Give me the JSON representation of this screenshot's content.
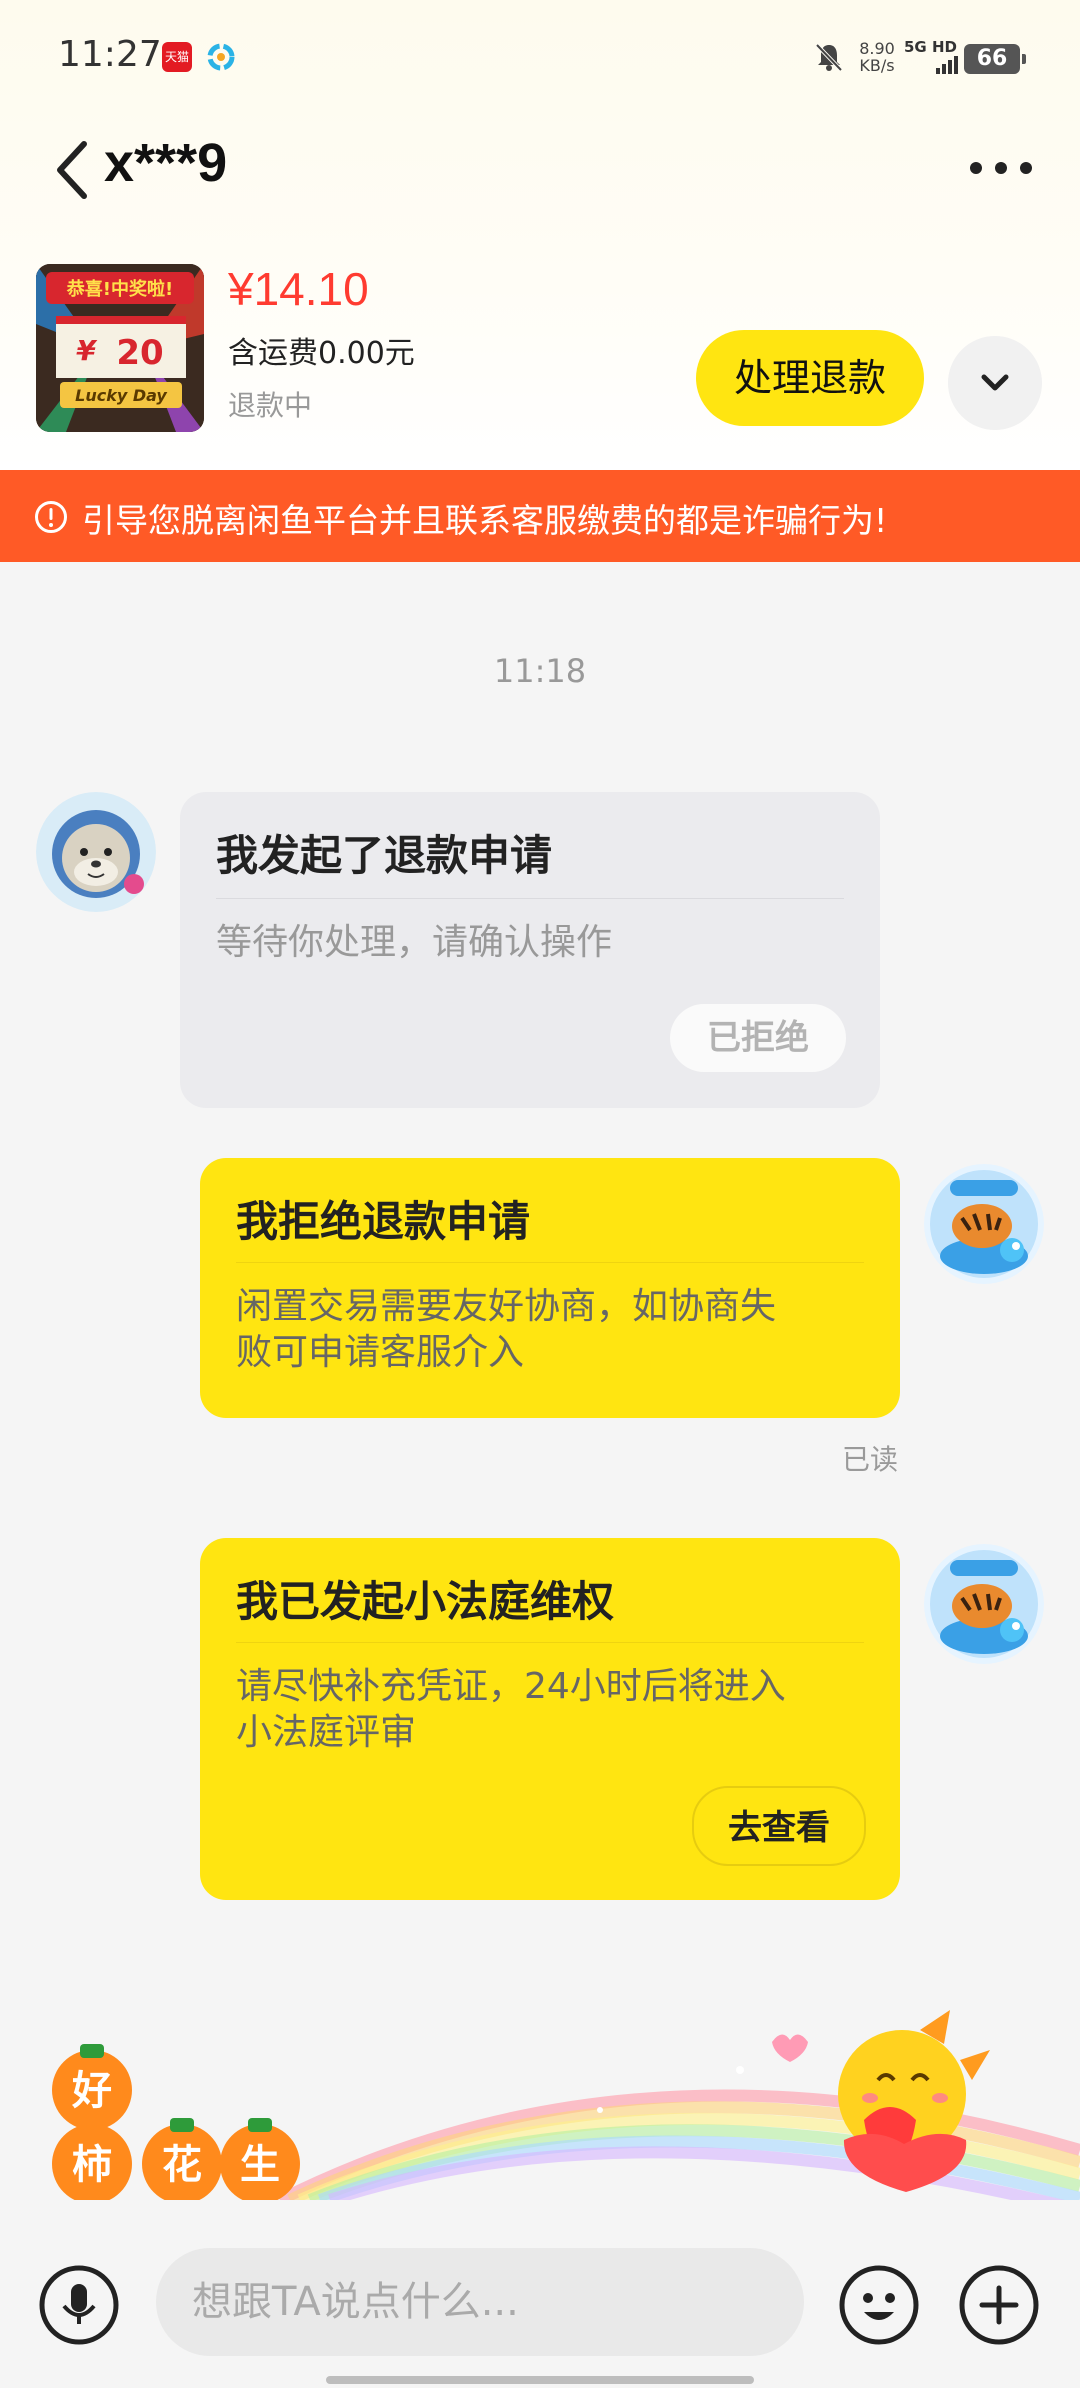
{
  "status_bar": {
    "time": "11:27",
    "app_badge_1": "天猫",
    "net_speed_value": "8.90",
    "net_speed_unit": "KB/s",
    "network": "5G HD",
    "battery": "66"
  },
  "header": {
    "contact_name": "x***9"
  },
  "product": {
    "price": "¥14.10",
    "shipping": "含运费0.00元",
    "status": "退款中",
    "thumb_banner": "恭喜!中奖啦!",
    "thumb_number": "20",
    "thumb_tag": "Lucky Day",
    "action_label": "处理退款"
  },
  "warning": {
    "text": "引导您脱离闲鱼平台并且联系客服缴费的都是诈骗行为!"
  },
  "chat": {
    "timestamp": "11:18",
    "messages": [
      {
        "title": "我发起了退款申请",
        "body": "等待你处理，请确认操作",
        "button": "已拒绝"
      },
      {
        "title": "我拒绝退款申请",
        "body_line1": "闲置交易需要友好协商，如协商失",
        "body_line2": "败可申请客服介入",
        "read": "已读"
      },
      {
        "title": "我已发起小法庭维权",
        "body_line1": "请尽快补充凭证，24小时后将进入",
        "body_line2": "小法庭评审",
        "button": "去查看"
      }
    ]
  },
  "sticker": {
    "chars": [
      "好",
      "柿",
      "花",
      "生"
    ]
  },
  "input": {
    "placeholder": "想跟TA说点什么..."
  },
  "colors": {
    "accent_yellow": "#ffe511",
    "price_red": "#ff3b30",
    "warning_orange": "#ff5a26"
  },
  "icons": [
    "back-arrow-icon",
    "more-dots-icon",
    "chevron-down-icon",
    "warning-circle-icon",
    "microphone-icon",
    "emoji-icon",
    "plus-icon"
  ]
}
